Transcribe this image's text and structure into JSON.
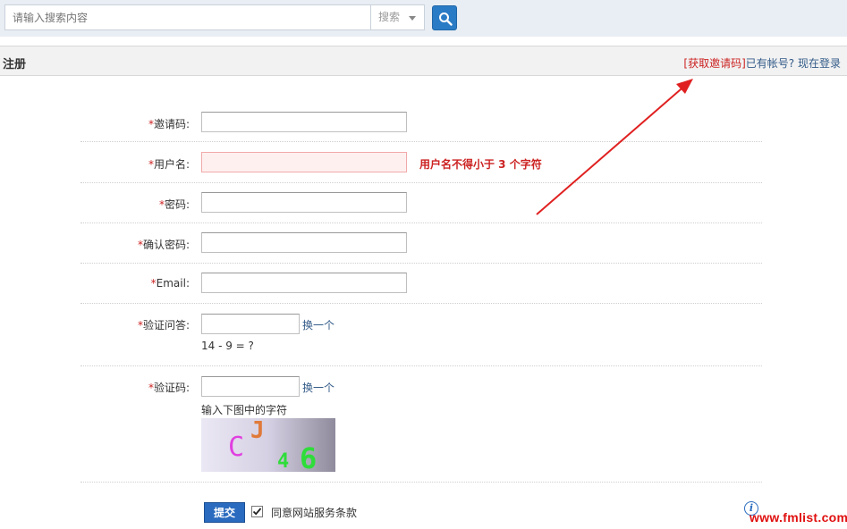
{
  "search": {
    "placeholder": "请输入搜索内容",
    "type_label": "搜索"
  },
  "header": {
    "title": "注册",
    "invite_link": "[获取邀请码]",
    "has_account": "已有帐号?",
    "login_link": "现在登录"
  },
  "form": {
    "required_mark": "*",
    "invite_code": {
      "label": "邀请码:"
    },
    "username": {
      "label": "用户名:",
      "error": "用户名不得小于 3 个字符"
    },
    "password": {
      "label": "密码:"
    },
    "confirm_password": {
      "label": "确认密码:"
    },
    "email": {
      "label": "Email:"
    },
    "qa": {
      "label": "验证问答:",
      "swap": "换一个",
      "question": "14 - 9 = ?"
    },
    "captcha": {
      "label": "验证码:",
      "swap": "换一个",
      "hint": "输入下图中的字符",
      "chars": [
        "C",
        "J",
        "4",
        "6"
      ]
    }
  },
  "submit": {
    "button": "提交",
    "agree_label": "同意网站服务条款",
    "agree_checked": true
  },
  "watermark": "www.fmlist.com",
  "colors": {
    "accent": "#2a6bbf",
    "error": "#cc2222"
  }
}
